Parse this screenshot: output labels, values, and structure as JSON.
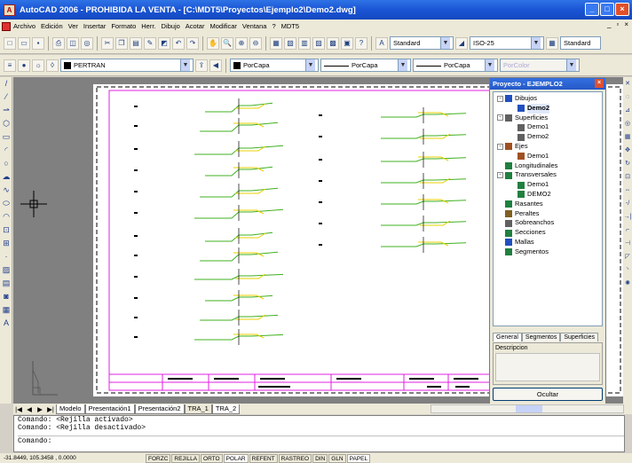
{
  "window": {
    "title": "AutoCAD 2006 - PROHIBIDA LA VENTA - [C:\\MDT5\\Proyectos\\Ejemplo2\\Demo2.dwg]"
  },
  "menu": {
    "items": [
      "Archivo",
      "Edición",
      "Ver",
      "Insertar",
      "Formato",
      "Herr.",
      "Dibujo",
      "Acotar",
      "Modificar",
      "Ventana",
      "?",
      "MDT5"
    ]
  },
  "toolbar": {
    "text_style": "Standard",
    "dim_style": "ISO-25",
    "table_style": "Standard",
    "layer": "PERTRAN",
    "color": "PorCapa",
    "linetype": "PorCapa",
    "lineweight": "PorCapa",
    "plotstyle": "PorColor"
  },
  "panel": {
    "title": "Proyecto - EJEMPLO2",
    "tree": [
      {
        "label": "Dibujos",
        "level": 0,
        "expander": "-",
        "icon": "folder-icon",
        "color": "#2050c0"
      },
      {
        "label": "Demo2",
        "level": 1,
        "expander": "",
        "icon": "drawing-icon",
        "color": "#2050c0",
        "selected": true
      },
      {
        "label": "Superficies",
        "level": 0,
        "expander": "-",
        "icon": "surface-icon",
        "color": "#606060"
      },
      {
        "label": "Demo1",
        "level": 1,
        "expander": "",
        "icon": "surface-icon",
        "color": "#606060"
      },
      {
        "label": "Demo2",
        "level": 1,
        "expander": "",
        "icon": "surface-icon",
        "color": "#606060"
      },
      {
        "label": "Ejes",
        "level": 0,
        "expander": "-",
        "icon": "axis-icon",
        "color": "#a05020"
      },
      {
        "label": "Demo1",
        "level": 1,
        "expander": "",
        "icon": "axis-icon",
        "color": "#a05020"
      },
      {
        "label": "Longitudinales",
        "level": 0,
        "expander": "",
        "icon": "profile-icon",
        "color": "#208040"
      },
      {
        "label": "Transversales",
        "level": 0,
        "expander": "-",
        "icon": "cross-section-icon",
        "color": "#208040"
      },
      {
        "label": "Demo1",
        "level": 1,
        "expander": "",
        "icon": "cross-section-icon",
        "color": "#208040"
      },
      {
        "label": "DEMO2",
        "level": 1,
        "expander": "",
        "icon": "cross-section-icon",
        "color": "#208040"
      },
      {
        "label": "Rasantes",
        "level": 0,
        "expander": "",
        "icon": "grade-icon",
        "color": "#208040"
      },
      {
        "label": "Peraltes",
        "level": 0,
        "expander": "",
        "icon": "superelevation-icon",
        "color": "#806020"
      },
      {
        "label": "Sobreanchos",
        "level": 0,
        "expander": "",
        "icon": "widening-icon",
        "color": "#606060"
      },
      {
        "label": "Secciones",
        "level": 0,
        "expander": "",
        "icon": "sections-icon",
        "color": "#208040"
      },
      {
        "label": "Mallas",
        "level": 0,
        "expander": "",
        "icon": "mesh-icon",
        "color": "#2050c0"
      },
      {
        "label": "Segmentos",
        "level": 0,
        "expander": "",
        "icon": "segments-icon",
        "color": "#208040"
      }
    ],
    "tabs": [
      "General",
      "Segmentos",
      "Superficies"
    ],
    "description_label": "Descripcion",
    "hide_button": "Ocultar"
  },
  "layout_tabs": [
    "Modelo",
    "Presentación1",
    "Presentación2",
    "TRA_1",
    "TRA_2"
  ],
  "command": {
    "lines": [
      "Comando:  <Rejilla activado>",
      "Comando:  <Rejilla desactivado>"
    ],
    "prompt": "Comando:"
  },
  "status": {
    "coords": "-31.8449, 105.3458 , 0.0000",
    "toggles": [
      {
        "label": "FORZC",
        "on": false
      },
      {
        "label": "REJILLA",
        "on": false
      },
      {
        "label": "ORTO",
        "on": false
      },
      {
        "label": "POLAR",
        "on": true
      },
      {
        "label": "REFENT",
        "on": false
      },
      {
        "label": "RASTREO",
        "on": false
      },
      {
        "label": "DIN",
        "on": false
      },
      {
        "label": "GLN",
        "on": false
      },
      {
        "label": "PAPEL",
        "on": true
      }
    ]
  },
  "colors": {
    "titlebar": "#1a55d4",
    "frame_magenta": "#e020e0",
    "section_green": "#40b020",
    "section_yellow": "#e8d000"
  }
}
